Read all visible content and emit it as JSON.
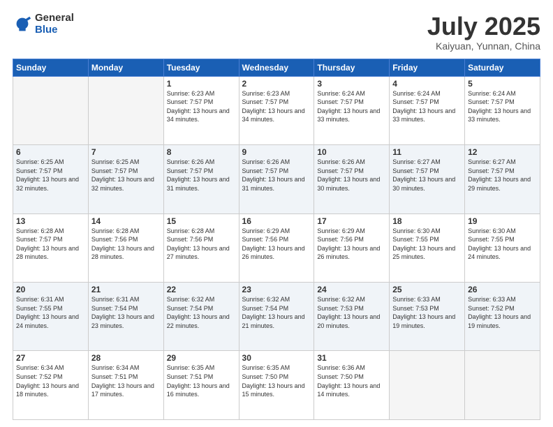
{
  "header": {
    "logo_general": "General",
    "logo_blue": "Blue",
    "title": "July 2025",
    "subtitle": "Kaiyuan, Yunnan, China"
  },
  "weekdays": [
    "Sunday",
    "Monday",
    "Tuesday",
    "Wednesday",
    "Thursday",
    "Friday",
    "Saturday"
  ],
  "weeks": [
    [
      {
        "day": null
      },
      {
        "day": null
      },
      {
        "day": "1",
        "sunrise": "Sunrise: 6:23 AM",
        "sunset": "Sunset: 7:57 PM",
        "daylight": "Daylight: 13 hours and 34 minutes."
      },
      {
        "day": "2",
        "sunrise": "Sunrise: 6:23 AM",
        "sunset": "Sunset: 7:57 PM",
        "daylight": "Daylight: 13 hours and 34 minutes."
      },
      {
        "day": "3",
        "sunrise": "Sunrise: 6:24 AM",
        "sunset": "Sunset: 7:57 PM",
        "daylight": "Daylight: 13 hours and 33 minutes."
      },
      {
        "day": "4",
        "sunrise": "Sunrise: 6:24 AM",
        "sunset": "Sunset: 7:57 PM",
        "daylight": "Daylight: 13 hours and 33 minutes."
      },
      {
        "day": "5",
        "sunrise": "Sunrise: 6:24 AM",
        "sunset": "Sunset: 7:57 PM",
        "daylight": "Daylight: 13 hours and 33 minutes."
      }
    ],
    [
      {
        "day": "6",
        "sunrise": "Sunrise: 6:25 AM",
        "sunset": "Sunset: 7:57 PM",
        "daylight": "Daylight: 13 hours and 32 minutes."
      },
      {
        "day": "7",
        "sunrise": "Sunrise: 6:25 AM",
        "sunset": "Sunset: 7:57 PM",
        "daylight": "Daylight: 13 hours and 32 minutes."
      },
      {
        "day": "8",
        "sunrise": "Sunrise: 6:26 AM",
        "sunset": "Sunset: 7:57 PM",
        "daylight": "Daylight: 13 hours and 31 minutes."
      },
      {
        "day": "9",
        "sunrise": "Sunrise: 6:26 AM",
        "sunset": "Sunset: 7:57 PM",
        "daylight": "Daylight: 13 hours and 31 minutes."
      },
      {
        "day": "10",
        "sunrise": "Sunrise: 6:26 AM",
        "sunset": "Sunset: 7:57 PM",
        "daylight": "Daylight: 13 hours and 30 minutes."
      },
      {
        "day": "11",
        "sunrise": "Sunrise: 6:27 AM",
        "sunset": "Sunset: 7:57 PM",
        "daylight": "Daylight: 13 hours and 30 minutes."
      },
      {
        "day": "12",
        "sunrise": "Sunrise: 6:27 AM",
        "sunset": "Sunset: 7:57 PM",
        "daylight": "Daylight: 13 hours and 29 minutes."
      }
    ],
    [
      {
        "day": "13",
        "sunrise": "Sunrise: 6:28 AM",
        "sunset": "Sunset: 7:57 PM",
        "daylight": "Daylight: 13 hours and 28 minutes."
      },
      {
        "day": "14",
        "sunrise": "Sunrise: 6:28 AM",
        "sunset": "Sunset: 7:56 PM",
        "daylight": "Daylight: 13 hours and 28 minutes."
      },
      {
        "day": "15",
        "sunrise": "Sunrise: 6:28 AM",
        "sunset": "Sunset: 7:56 PM",
        "daylight": "Daylight: 13 hours and 27 minutes."
      },
      {
        "day": "16",
        "sunrise": "Sunrise: 6:29 AM",
        "sunset": "Sunset: 7:56 PM",
        "daylight": "Daylight: 13 hours and 26 minutes."
      },
      {
        "day": "17",
        "sunrise": "Sunrise: 6:29 AM",
        "sunset": "Sunset: 7:56 PM",
        "daylight": "Daylight: 13 hours and 26 minutes."
      },
      {
        "day": "18",
        "sunrise": "Sunrise: 6:30 AM",
        "sunset": "Sunset: 7:55 PM",
        "daylight": "Daylight: 13 hours and 25 minutes."
      },
      {
        "day": "19",
        "sunrise": "Sunrise: 6:30 AM",
        "sunset": "Sunset: 7:55 PM",
        "daylight": "Daylight: 13 hours and 24 minutes."
      }
    ],
    [
      {
        "day": "20",
        "sunrise": "Sunrise: 6:31 AM",
        "sunset": "Sunset: 7:55 PM",
        "daylight": "Daylight: 13 hours and 24 minutes."
      },
      {
        "day": "21",
        "sunrise": "Sunrise: 6:31 AM",
        "sunset": "Sunset: 7:54 PM",
        "daylight": "Daylight: 13 hours and 23 minutes."
      },
      {
        "day": "22",
        "sunrise": "Sunrise: 6:32 AM",
        "sunset": "Sunset: 7:54 PM",
        "daylight": "Daylight: 13 hours and 22 minutes."
      },
      {
        "day": "23",
        "sunrise": "Sunrise: 6:32 AM",
        "sunset": "Sunset: 7:54 PM",
        "daylight": "Daylight: 13 hours and 21 minutes."
      },
      {
        "day": "24",
        "sunrise": "Sunrise: 6:32 AM",
        "sunset": "Sunset: 7:53 PM",
        "daylight": "Daylight: 13 hours and 20 minutes."
      },
      {
        "day": "25",
        "sunrise": "Sunrise: 6:33 AM",
        "sunset": "Sunset: 7:53 PM",
        "daylight": "Daylight: 13 hours and 19 minutes."
      },
      {
        "day": "26",
        "sunrise": "Sunrise: 6:33 AM",
        "sunset": "Sunset: 7:52 PM",
        "daylight": "Daylight: 13 hours and 19 minutes."
      }
    ],
    [
      {
        "day": "27",
        "sunrise": "Sunrise: 6:34 AM",
        "sunset": "Sunset: 7:52 PM",
        "daylight": "Daylight: 13 hours and 18 minutes."
      },
      {
        "day": "28",
        "sunrise": "Sunrise: 6:34 AM",
        "sunset": "Sunset: 7:51 PM",
        "daylight": "Daylight: 13 hours and 17 minutes."
      },
      {
        "day": "29",
        "sunrise": "Sunrise: 6:35 AM",
        "sunset": "Sunset: 7:51 PM",
        "daylight": "Daylight: 13 hours and 16 minutes."
      },
      {
        "day": "30",
        "sunrise": "Sunrise: 6:35 AM",
        "sunset": "Sunset: 7:50 PM",
        "daylight": "Daylight: 13 hours and 15 minutes."
      },
      {
        "day": "31",
        "sunrise": "Sunrise: 6:36 AM",
        "sunset": "Sunset: 7:50 PM",
        "daylight": "Daylight: 13 hours and 14 minutes."
      },
      {
        "day": null
      },
      {
        "day": null
      }
    ]
  ]
}
